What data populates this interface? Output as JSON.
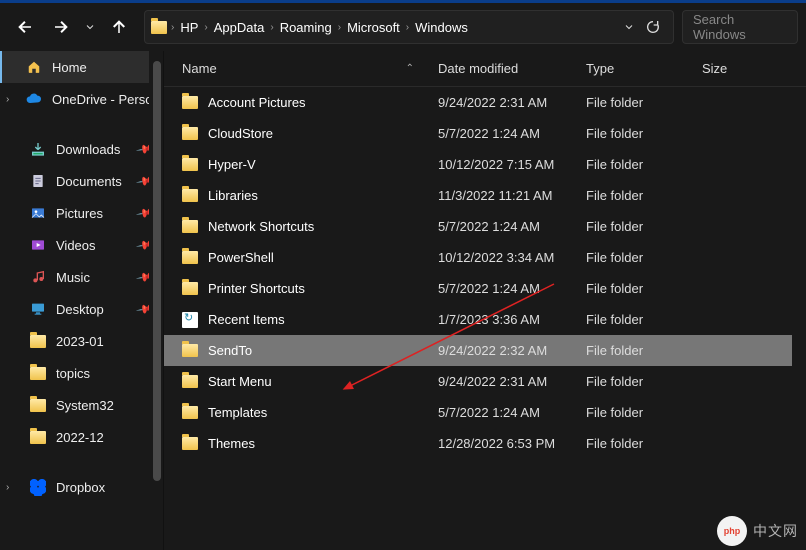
{
  "breadcrumbs": [
    "HP",
    "AppData",
    "Roaming",
    "Microsoft",
    "Windows"
  ],
  "search": {
    "placeholder": "Search Windows"
  },
  "columns": {
    "name": "Name",
    "date": "Date modified",
    "type": "Type",
    "size": "Size"
  },
  "sidebar": {
    "home": "Home",
    "onedrive": "OneDrive - Perso",
    "quick": [
      {
        "label": "Downloads",
        "icon": "download"
      },
      {
        "label": "Documents",
        "icon": "document"
      },
      {
        "label": "Pictures",
        "icon": "pictures"
      },
      {
        "label": "Videos",
        "icon": "videos"
      },
      {
        "label": "Music",
        "icon": "music"
      },
      {
        "label": "Desktop",
        "icon": "desktop"
      },
      {
        "label": "2023-01",
        "icon": "folder"
      },
      {
        "label": "topics",
        "icon": "folder"
      },
      {
        "label": "System32",
        "icon": "folder"
      },
      {
        "label": "2022-12",
        "icon": "folder"
      }
    ],
    "dropbox": "Dropbox"
  },
  "rows": [
    {
      "name": "Account Pictures",
      "date": "9/24/2022 2:31 AM",
      "type": "File folder",
      "icon": "folder"
    },
    {
      "name": "CloudStore",
      "date": "5/7/2022 1:24 AM",
      "type": "File folder",
      "icon": "folder"
    },
    {
      "name": "Hyper-V",
      "date": "10/12/2022 7:15 AM",
      "type": "File folder",
      "icon": "folder"
    },
    {
      "name": "Libraries",
      "date": "11/3/2022 11:21 AM",
      "type": "File folder",
      "icon": "folder"
    },
    {
      "name": "Network Shortcuts",
      "date": "5/7/2022 1:24 AM",
      "type": "File folder",
      "icon": "folder"
    },
    {
      "name": "PowerShell",
      "date": "10/12/2022 3:34 AM",
      "type": "File folder",
      "icon": "folder"
    },
    {
      "name": "Printer Shortcuts",
      "date": "5/7/2022 1:24 AM",
      "type": "File folder",
      "icon": "folder"
    },
    {
      "name": "Recent Items",
      "date": "1/7/2023 3:36 AM",
      "type": "File folder",
      "icon": "recent"
    },
    {
      "name": "SendTo",
      "date": "9/24/2022 2:32 AM",
      "type": "File folder",
      "icon": "folder",
      "selected": true
    },
    {
      "name": "Start Menu",
      "date": "9/24/2022 2:31 AM",
      "type": "File folder",
      "icon": "folder"
    },
    {
      "name": "Templates",
      "date": "5/7/2022 1:24 AM",
      "type": "File folder",
      "icon": "folder"
    },
    {
      "name": "Themes",
      "date": "12/28/2022 6:53 PM",
      "type": "File folder",
      "icon": "folder"
    }
  ],
  "watermark": {
    "logo": "php",
    "text": "中文网"
  }
}
